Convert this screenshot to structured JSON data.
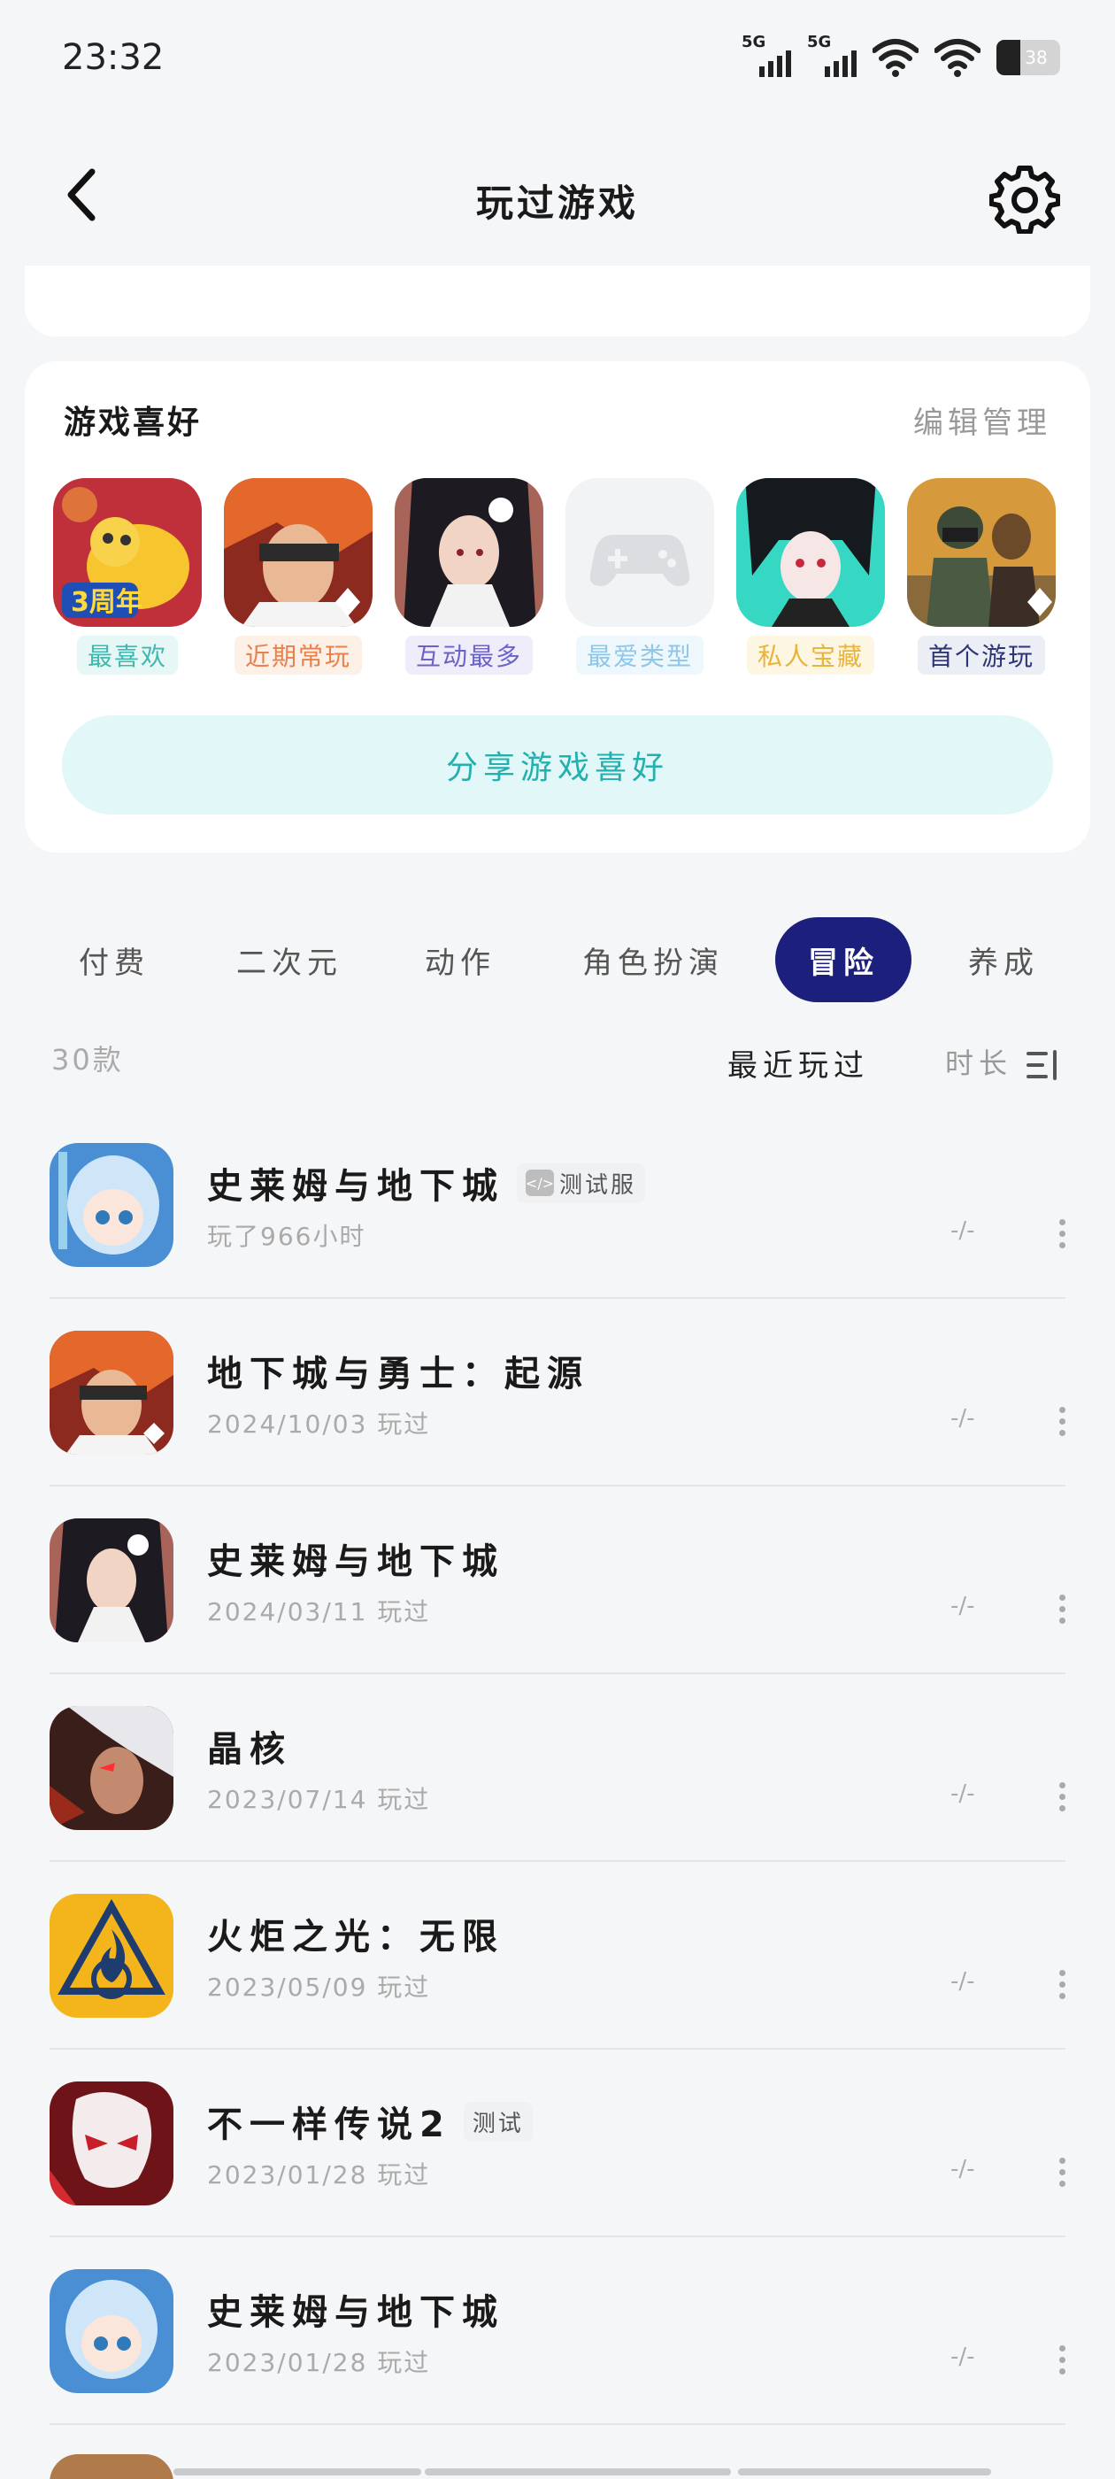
{
  "status_bar": {
    "time": "23:32",
    "signal1": "5G",
    "signal2": "5G",
    "battery": "38"
  },
  "header": {
    "title": "玩过游戏"
  },
  "preferences": {
    "title": "游戏喜好",
    "edit_label": "编辑管理",
    "items": [
      {
        "tag": "最喜欢",
        "tag_color": "#3fb8b0",
        "tag_bg": "#e6f7f5",
        "icon": "cartoon-mascot-3-anniversary-icon"
      },
      {
        "tag": "近期常玩",
        "tag_color": "#e8814c",
        "tag_bg": "#fdf0e7",
        "icon": "warrior-red-hair-icon"
      },
      {
        "tag": "互动最多",
        "tag_color": "#6c63c9",
        "tag_bg": "#eeedf9",
        "icon": "anime-girl-dark-hair-icon"
      },
      {
        "tag": "最爱类型",
        "tag_color": "#8fc7e8",
        "tag_bg": "#eef7fc",
        "icon": "gamepad-placeholder-icon"
      },
      {
        "tag": "私人宝藏",
        "tag_color": "#e8b43c",
        "tag_bg": "#fdf6e3",
        "icon": "dark-hair-girl-teal-icon"
      },
      {
        "tag": "首个游玩",
        "tag_color": "#2e3575",
        "tag_bg": "#eceef6",
        "icon": "battle-royale-soldiers-icon"
      }
    ],
    "share_label": "分享游戏喜好"
  },
  "category_tabs": [
    "付费",
    "二次元",
    "动作",
    "角色扮演",
    "冒险",
    "养成"
  ],
  "active_tab": "冒险",
  "list_header": {
    "count": "30款",
    "sort_recent": "最近玩过",
    "sort_duration": "时长"
  },
  "games": [
    {
      "name": "史莱姆与地下城",
      "badge": "测试服",
      "badge_code": true,
      "sub": "玩了966小时",
      "rating": "-/-",
      "icon": "blue-hair-chibi-girl-icon"
    },
    {
      "name": "地下城与勇士：起源",
      "badge": "",
      "sub": "2024/10/03 玩过",
      "rating": "-/-",
      "icon": "warrior-red-hair-icon"
    },
    {
      "name": "史莱姆与地下城",
      "badge": "",
      "sub": "2024/03/11 玩过",
      "rating": "-/-",
      "icon": "anime-girl-dark-hair-icon"
    },
    {
      "name": "晶核",
      "badge": "",
      "sub": "2023/07/14 玩过",
      "rating": "-/-",
      "icon": "white-hair-warrior-icon"
    },
    {
      "name": "火炬之光：无限",
      "badge": "",
      "sub": "2023/05/09 玩过",
      "rating": "-/-",
      "icon": "flame-emblem-icon"
    },
    {
      "name": "不一样传说2",
      "badge": "测试",
      "badge_code": false,
      "sub": "2023/01/28 玩过",
      "rating": "-/-",
      "icon": "red-white-mask-icon"
    },
    {
      "name": "史莱姆与地下城",
      "badge": "",
      "sub": "2023/01/28 玩过",
      "rating": "-/-",
      "icon": "blue-hair-chibi-girl-icon"
    }
  ]
}
